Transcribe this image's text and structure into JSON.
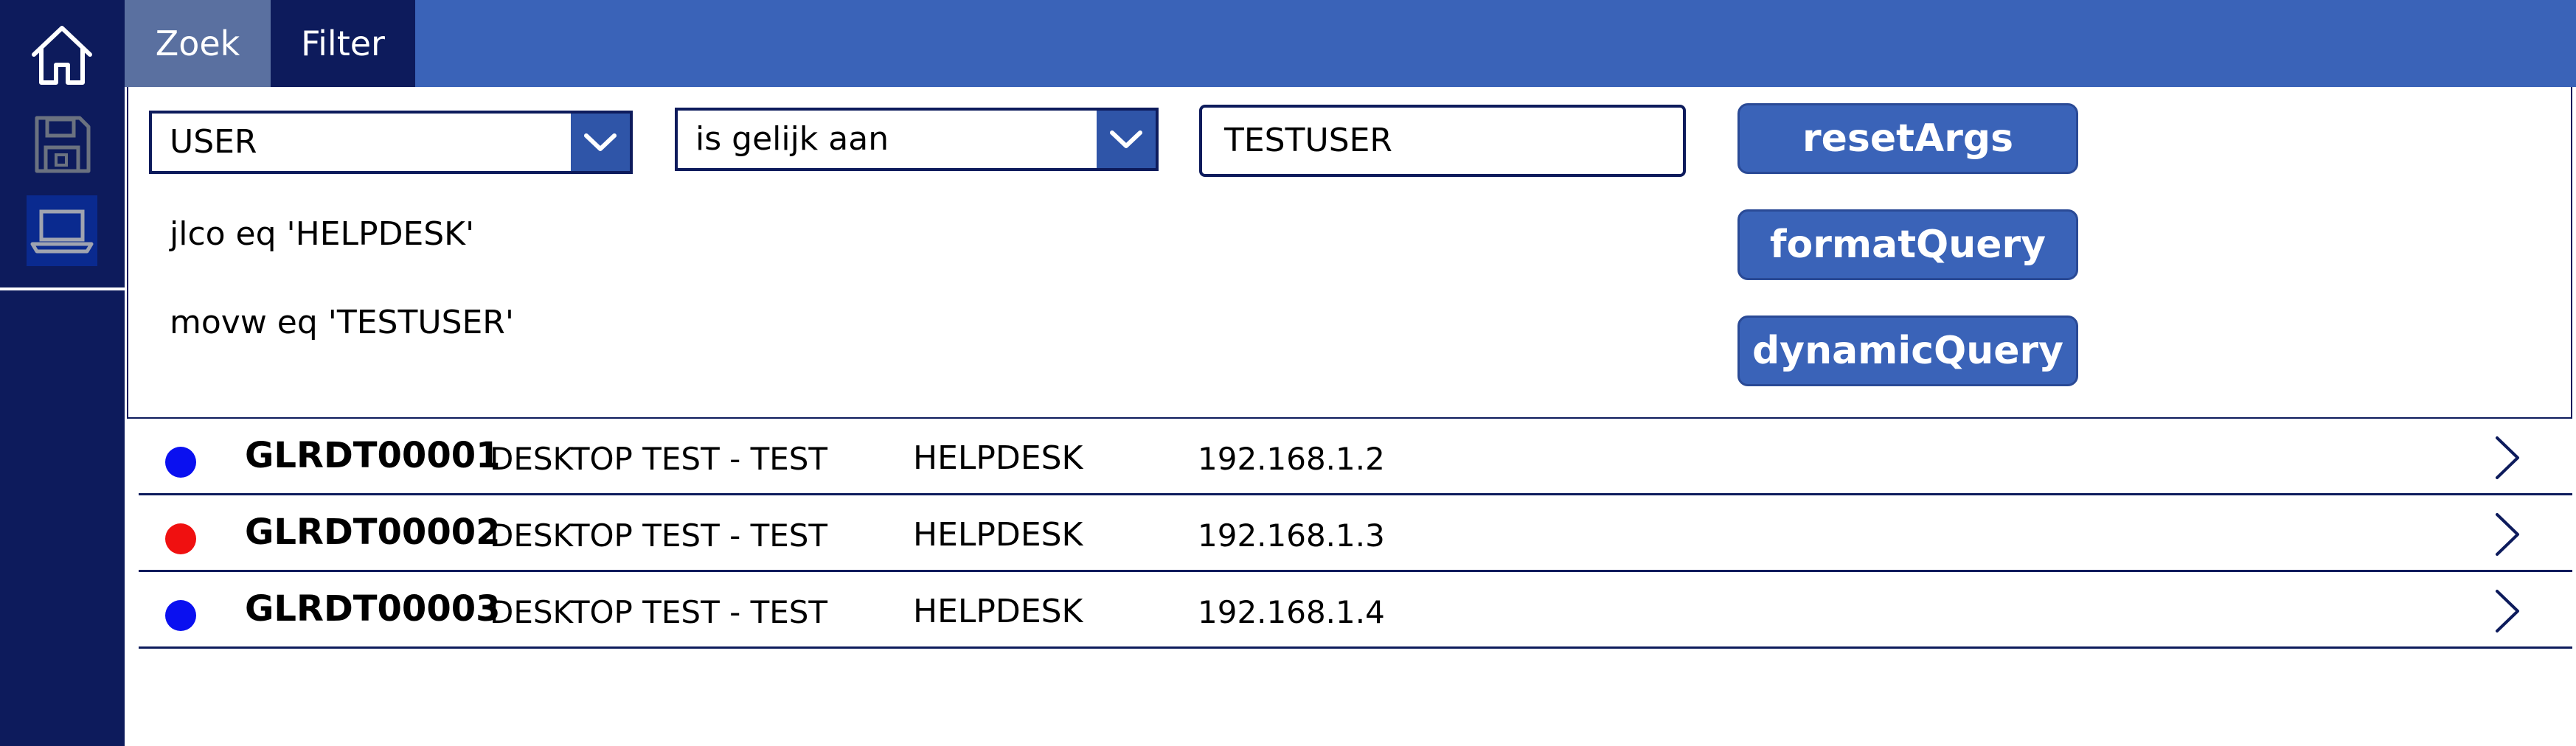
{
  "nav": {
    "items": [
      {
        "icon": "home-icon",
        "active": false
      },
      {
        "icon": "save-icon",
        "active": false
      },
      {
        "icon": "laptop-icon",
        "active": true
      }
    ]
  },
  "tabs": [
    {
      "label": "Zoek",
      "active": false
    },
    {
      "label": "Filter",
      "active": true
    }
  ],
  "filter": {
    "field": "USER",
    "operator": "is gelijk aan",
    "value": "TESTUSER",
    "queries": [
      "jlco eq 'HELPDESK'",
      "movw eq 'TESTUSER'"
    ]
  },
  "actions": {
    "reset": "resetArgs",
    "format": "formatQuery",
    "dynamic": "dynamicQuery"
  },
  "devices": [
    {
      "name": "GLRDT00001",
      "description": "DESKTOP TEST - TEST",
      "department": "HELPDESK",
      "ip": "192.168.1.2",
      "status_color": "#0a10f0"
    },
    {
      "name": "GLRDT00002",
      "description": "DESKTOP TEST - TEST",
      "department": "HELPDESK",
      "ip": "192.168.1.3",
      "status_color": "#f01010"
    },
    {
      "name": "GLRDT00003",
      "description": "DESKTOP TEST - TEST",
      "department": "HELPDESK",
      "ip": "192.168.1.4",
      "status_color": "#0a10f0"
    }
  ],
  "colors": {
    "nav_bg": "#0d1b5c",
    "topbar_bg": "#3a63b8",
    "button_bg": "#3a63b8",
    "status_blue": "#0a10f0",
    "status_red": "#f01010"
  }
}
